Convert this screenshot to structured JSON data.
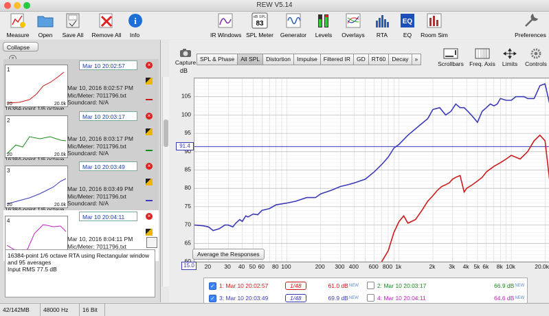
{
  "window": {
    "title": "REW V5.14"
  },
  "toolbar": {
    "left": [
      {
        "label": "Measure",
        "icon": "measure-icon"
      },
      {
        "label": "Open",
        "icon": "folder-icon"
      },
      {
        "label": "Save All",
        "icon": "save-icon"
      },
      {
        "label": "Remove All",
        "icon": "remove-all-icon"
      },
      {
        "label": "Info",
        "icon": "info-icon"
      }
    ],
    "center": [
      {
        "label": "IR Windows",
        "icon": "ir-windows-icon"
      },
      {
        "label": "SPL Meter",
        "icon": "spl-meter-icon",
        "display_top": "dB SPL",
        "display_value": "83"
      },
      {
        "label": "Generator",
        "icon": "generator-icon"
      },
      {
        "label": "Levels",
        "icon": "levels-icon"
      },
      {
        "label": "Overlays",
        "icon": "overlays-icon"
      },
      {
        "label": "RTA",
        "icon": "rta-icon"
      },
      {
        "label": "EQ",
        "icon": "eq-icon",
        "glyph": "EQ"
      },
      {
        "label": "Room Sim",
        "icon": "room-sim-icon"
      }
    ],
    "right": {
      "label": "Preferences",
      "icon": "preferences-icon"
    }
  },
  "left_panel": {
    "collapse_label": "Collapse",
    "measurements": [
      {
        "num": "1",
        "date": "Mar 10 20:02:57",
        "line1": "Mar 10, 2016 8:02:57 PM",
        "line2": "Mic/Meter: 7011796.txt",
        "line3": "Soundcard: N/A",
        "label": "16384-point 1/6 octave",
        "color": "#cc1a1a"
      },
      {
        "num": "2",
        "date": "Mar 10 20:03:17",
        "line1": "Mar 10, 2016 8:03:17 PM",
        "line2": "Mic/Meter: 7011796.txt",
        "line3": "Soundcard: N/A",
        "label": "16384-point 1/6 octave",
        "color": "#1a8a1a"
      },
      {
        "num": "3",
        "date": "Mar 10 20:03:49",
        "line1": "Mar 10, 2016 8:03:49 PM",
        "line2": "Mic/Meter: 7011796.txt",
        "line3": "Soundcard: N/A",
        "label": "16384-point 1/6 octave",
        "color": "#3a3ab8"
      },
      {
        "num": "4",
        "date": "Mar 10 20:04:11",
        "line1": "Mar 10, 2016 8:04:11 PM",
        "line2": "Mic/Meter: 7011796.txt",
        "line3": "Soundcard: N/A",
        "label": "",
        "color": "#c020c0"
      }
    ],
    "thumb_x_start": "20",
    "thumb_x_end": "20.0k",
    "description": [
      "16384-point 1/6 octave RTA using Rectangular window",
      "and 95 averages",
      "Input RMS 77.5 dB"
    ]
  },
  "main": {
    "capture_label": "Capture",
    "tabs": [
      "SPL & Phase",
      "All SPL",
      "Distortion",
      "Impulse",
      "Filtered IR",
      "GD",
      "RT60",
      "Decay",
      "»"
    ],
    "active_tab": "All SPL",
    "right_tools": [
      {
        "label": "Scrollbars",
        "icon": "scrollbars-icon"
      },
      {
        "label": "Freq. Axis",
        "icon": "freq-axis-icon"
      },
      {
        "label": "Limits",
        "icon": "limits-icon"
      },
      {
        "label": "Controls",
        "icon": "controls-icon"
      }
    ],
    "average_button": "Average the Responses",
    "cursor_value": "91.4",
    "x_start_value": "15.0"
  },
  "chart_data": {
    "type": "line",
    "ylabel": "dB",
    "xlabel": "",
    "x_scale": "log",
    "xlim": [
      15,
      22000
    ],
    "ylim": [
      60,
      110
    ],
    "y_ticks": [
      60,
      65,
      70,
      75,
      80,
      85,
      90,
      95,
      100,
      105
    ],
    "x_ticks": [
      {
        "label": "20",
        "value": 20
      },
      {
        "label": "30",
        "value": 30
      },
      {
        "label": "40",
        "value": 40
      },
      {
        "label": "50",
        "value": 50
      },
      {
        "label": "60",
        "value": 60
      },
      {
        "label": "80",
        "value": 80
      },
      {
        "label": "100",
        "value": 100
      },
      {
        "label": "200",
        "value": 200
      },
      {
        "label": "300",
        "value": 300
      },
      {
        "label": "400",
        "value": 400
      },
      {
        "label": "600",
        "value": 600
      },
      {
        "label": "800",
        "value": 800
      },
      {
        "label": "1k",
        "value": 1000
      },
      {
        "label": "2k",
        "value": 2000
      },
      {
        "label": "3k",
        "value": 3000
      },
      {
        "label": "4k",
        "value": 4000
      },
      {
        "label": "5k",
        "value": 5000
      },
      {
        "label": "6k",
        "value": 6000
      },
      {
        "label": "8k",
        "value": 8000
      },
      {
        "label": "10k",
        "value": 10000
      },
      {
        "label": "20.0k Hz",
        "value": 20000
      }
    ],
    "cursor_y": 91.4,
    "grid": true,
    "series": [
      {
        "color": "#3a3ab8",
        "x": [
          15,
          18,
          20,
          22,
          25,
          28,
          30,
          33,
          35,
          38,
          40,
          43,
          45,
          50,
          55,
          60,
          70,
          80,
          100,
          120,
          150,
          180,
          200,
          250,
          300,
          350,
          400,
          500,
          600,
          700,
          800,
          900,
          1000,
          1200,
          1500,
          1800,
          2000,
          2300,
          2600,
          2900,
          3200,
          3500,
          3800,
          4100,
          4400,
          4700,
          5000,
          5500,
          6000,
          6500,
          7000,
          7500,
          8000,
          9000,
          10000,
          11000,
          12000,
          13000,
          14000,
          16000,
          18000,
          20000,
          22000
        ],
        "y": [
          70,
          69.8,
          69.5,
          68.5,
          69,
          70,
          70,
          69.5,
          70.5,
          71.5,
          71,
          72.5,
          72.2,
          73,
          72.8,
          74,
          74.5,
          75.5,
          76,
          76.5,
          77.5,
          77.5,
          78.5,
          79.5,
          80.5,
          81,
          81.5,
          82.5,
          84.5,
          86.5,
          88.5,
          91,
          92,
          94.5,
          97,
          99,
          101.5,
          102,
          100,
          101,
          103,
          102,
          102,
          101,
          100,
          99,
          98,
          101,
          102,
          103,
          102.5,
          103,
          104.5,
          104,
          104,
          105,
          105,
          105,
          104.5,
          104.5,
          108,
          108.5,
          103
        ]
      },
      {
        "color": "#cc1a1a",
        "x": [
          700,
          800,
          900,
          1000,
          1100,
          1200,
          1400,
          1600,
          1800,
          2000,
          2200,
          2400,
          2600,
          2800,
          3000,
          3200,
          3500,
          3800,
          4000,
          4500,
          5000,
          5500,
          6000,
          7000,
          8000,
          9000,
          10000,
          12000,
          14000,
          16000,
          18000,
          20000,
          22000
        ],
        "y": [
          60,
          63,
          68,
          71,
          72.5,
          70.5,
          71.5,
          74,
          76.5,
          78,
          79.5,
          80.5,
          81,
          81.5,
          82.5,
          83,
          83.5,
          79,
          80,
          81,
          82,
          83,
          84.5,
          86,
          87,
          88,
          89,
          88,
          90,
          93,
          94.5,
          93,
          82
        ]
      }
    ]
  },
  "legend": {
    "items": [
      {
        "checked": true,
        "label": "1: Mar 10 20:02:57",
        "smoothing": "1/48",
        "value": "61.0 dB",
        "new": "NEW",
        "color": "#cc1a1a"
      },
      {
        "checked": false,
        "label": "2: Mar 10 20:03:17",
        "smoothing": "",
        "value": "66.9 dB",
        "new": "NEW",
        "color": "#1a8a1a"
      },
      {
        "checked": true,
        "label": "3: Mar 10 20:03:49",
        "smoothing": "1/48",
        "value": "69.9 dB",
        "new": "NEW",
        "color": "#3a3ab8"
      },
      {
        "checked": false,
        "label": "4: Mar 10 20:04:11",
        "smoothing": "",
        "value": "64.6 dB",
        "new": "NEW",
        "color": "#c020c0"
      }
    ]
  },
  "status": {
    "memory": "42/142MB",
    "rate": "48000 Hz",
    "bits": "16 Bit"
  }
}
